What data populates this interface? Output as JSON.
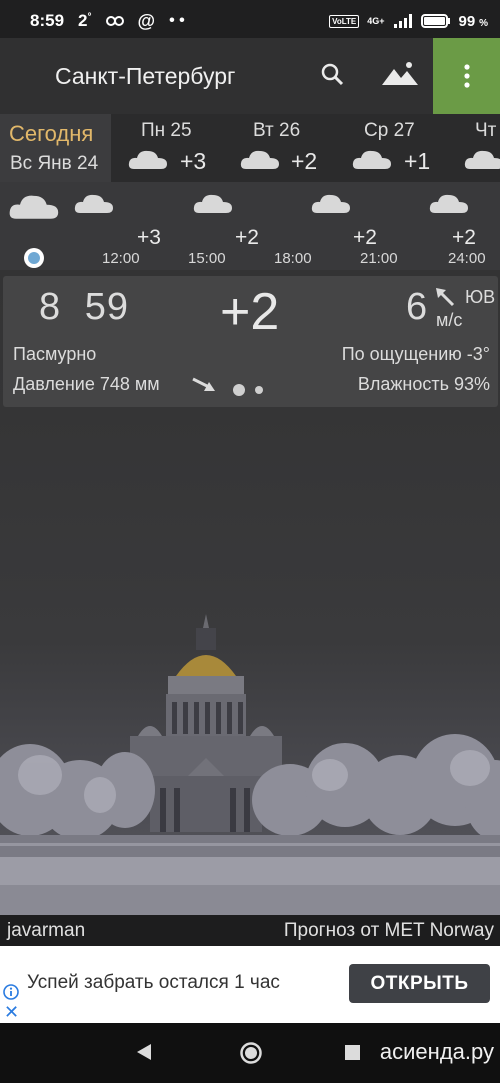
{
  "status_bar": {
    "time": "8:59",
    "notif_count": "2",
    "notif_sup": "°",
    "battery_pct": "99",
    "battery_unit": "%",
    "network": "4G+",
    "volte": "VoLTE"
  },
  "appbar": {
    "city": "Санкт-Петербург",
    "accent_color": "#6b9b46"
  },
  "days": {
    "today_label": "Сегодня",
    "today_date": "Вс Янв 24",
    "items": [
      {
        "name": "Пн 25",
        "temp": "+3"
      },
      {
        "name": "Вт 26",
        "temp": "+2"
      },
      {
        "name": "Ср 27",
        "temp": "+1"
      },
      {
        "name": "Чт",
        "temp": ""
      }
    ]
  },
  "hourly": {
    "items": [
      {
        "temp": "+3",
        "time": "12:00"
      },
      {
        "temp": "+2",
        "time": "15:00"
      },
      {
        "temp": "",
        "time": "18:00"
      },
      {
        "temp": "+2",
        "time": "21:00"
      },
      {
        "temp": "+2",
        "time": "24:00"
      }
    ]
  },
  "current": {
    "time": "8 59",
    "temperature": "+2",
    "wind_speed": "6",
    "wind_dir": "ЮВ",
    "wind_unit": "м/с",
    "condition": "Пасмурно",
    "feels_like": "По ощущению -3°",
    "pressure": "Давление 748 мм",
    "humidity": "Влажность 93%"
  },
  "credits": {
    "author": "javarman",
    "source": "Прогноз от MET Norway"
  },
  "ad": {
    "text": "Успей забрать остался 1 час",
    "button": "ОТКРЫТЬ"
  },
  "navbar": {
    "watermark": "асиенда.ру"
  }
}
